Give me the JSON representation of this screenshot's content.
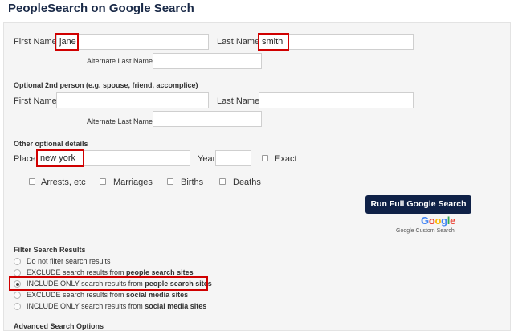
{
  "page": {
    "title": "PeopleSearch on Google Search"
  },
  "person1": {
    "first_name_label": "First Name",
    "first_name_value": "jane",
    "last_name_label": "Last Name",
    "last_name_value": "smith",
    "alt_last_label": "Alternate Last Name",
    "alt_last_value": ""
  },
  "person2": {
    "section_label": "Optional 2nd person (e.g. spouse, friend, accomplice)",
    "first_name_label": "First Name",
    "first_name_value": "",
    "last_name_label": "Last Name",
    "last_name_value": "",
    "alt_last_label": "Alternate Last Name",
    "alt_last_value": ""
  },
  "other": {
    "section_label": "Other optional details",
    "place_label": "Place",
    "place_value": "new york",
    "year_label": "Year",
    "year_value": "",
    "exact_label": "Exact",
    "checkboxes": [
      {
        "label": "Arrests, etc",
        "checked": false
      },
      {
        "label": "Marriages",
        "checked": false
      },
      {
        "label": "Births",
        "checked": false
      },
      {
        "label": "Deaths",
        "checked": false
      }
    ]
  },
  "run_button": {
    "label": "Run Full Google Search"
  },
  "branding": {
    "google_letters": [
      {
        "ch": "G",
        "color": "#4285F4"
      },
      {
        "ch": "o",
        "color": "#EA4335"
      },
      {
        "ch": "o",
        "color": "#FBBC05"
      },
      {
        "ch": "g",
        "color": "#4285F4"
      },
      {
        "ch": "l",
        "color": "#34A853"
      },
      {
        "ch": "e",
        "color": "#EA4335"
      }
    ],
    "custom_search": "Google Custom Search"
  },
  "filter": {
    "section_label": "Filter Search Results",
    "options": [
      {
        "pre": "Do not filter search results",
        "bold": "",
        "selected": false
      },
      {
        "pre": "EXCLUDE search results from ",
        "bold": "people search sites",
        "selected": false
      },
      {
        "pre": "INCLUDE ONLY search results from ",
        "bold": "people search sites",
        "selected": true
      },
      {
        "pre": "EXCLUDE search results from ",
        "bold": "social media sites",
        "selected": false
      },
      {
        "pre": "INCLUDE ONLY search results from ",
        "bold": "social media sites",
        "selected": false
      }
    ]
  },
  "advanced": {
    "label": "Advanced Search Options"
  },
  "colors": {
    "highlight": "#d00000",
    "button_bg": "#0f2147",
    "title": "#1a2a48"
  }
}
